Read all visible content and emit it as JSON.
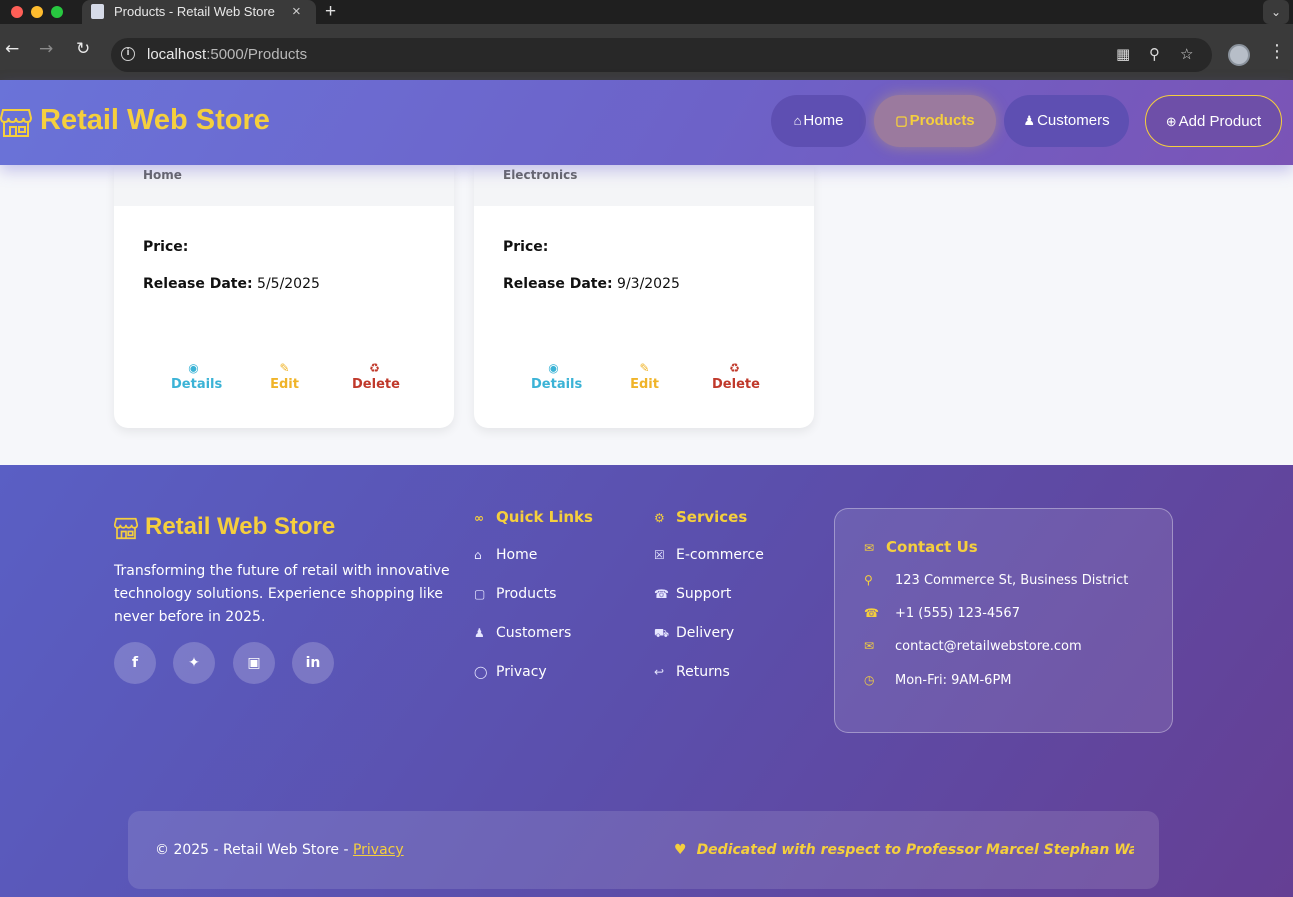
{
  "browser": {
    "tab_title": "Products - Retail Web Store",
    "tab_close": "×",
    "new_tab": "+",
    "url_host": "localhost",
    "url_path": ":5000/Products"
  },
  "header": {
    "brand": "Retail Web Store",
    "nav": [
      {
        "label": "Home",
        "icon": "home-icon"
      },
      {
        "label": "Products",
        "icon": "box-icon",
        "active": true
      },
      {
        "label": "Customers",
        "icon": "users-icon"
      },
      {
        "label": "Add Product",
        "icon": "plus-circle-icon"
      }
    ]
  },
  "products": [
    {
      "category": "Home",
      "price_label": "Price:",
      "release_label": "Release Date:",
      "release_date": "5/5/2025",
      "actions": {
        "details": "Details",
        "edit": "Edit",
        "delete": "Delete"
      }
    },
    {
      "category": "Electronics",
      "price_label": "Price:",
      "release_label": "Release Date:",
      "release_date": "9/3/2025",
      "actions": {
        "details": "Details",
        "edit": "Edit",
        "delete": "Delete"
      }
    }
  ],
  "footer": {
    "brand": "Retail Web Store",
    "tagline": "Transforming the future of retail with innovative technology solutions. Experience shopping like never before in 2025.",
    "social": [
      "facebook-icon",
      "twitter-icon",
      "instagram-icon",
      "linkedin-icon"
    ],
    "quick_links": {
      "title": "Quick Links",
      "items": [
        "Home",
        "Products",
        "Customers",
        "Privacy"
      ]
    },
    "services": {
      "title": "Services",
      "items": [
        "E-commerce",
        "Support",
        "Delivery",
        "Returns"
      ]
    },
    "contact": {
      "title": "Contact Us",
      "address": "123 Commerce St, Business District",
      "phone": "+1 (555) 123-4567",
      "email": "contact@retailwebstore.com",
      "hours": "Mon-Fri: 9AM-6PM"
    },
    "copyright": "© 2025 - Retail Web Store - ",
    "privacy_link": "Privacy",
    "dedication": "Dedicated with respect to Professor Marcel Stephan Wagner"
  },
  "colors": {
    "accent": "#f5cf3d",
    "header_gradient_start": "#6a73d8",
    "header_gradient_end": "#7b54b6",
    "details": "#3bb3d6",
    "edit": "#f0b429",
    "delete": "#c0392b"
  }
}
